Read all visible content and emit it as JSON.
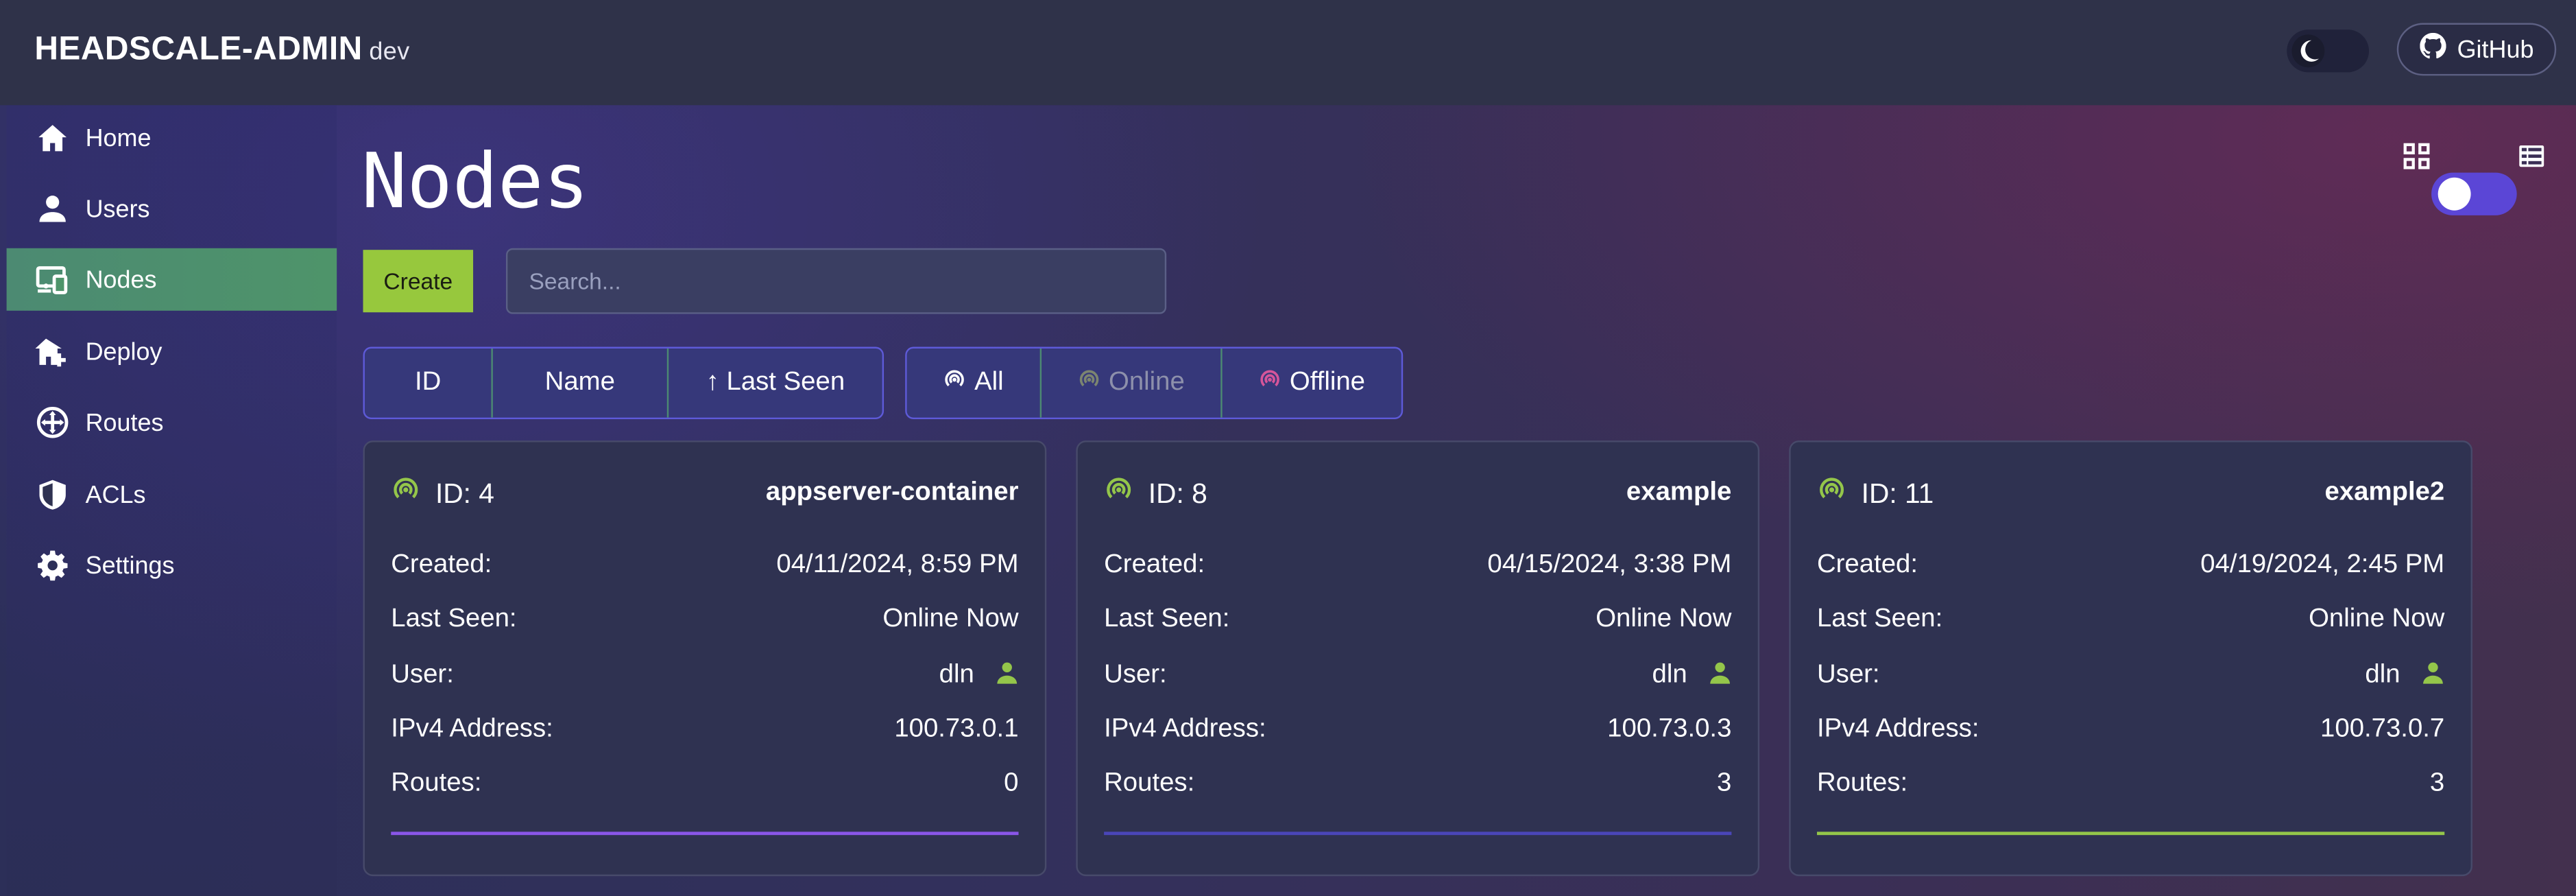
{
  "app": {
    "title": "HEADSCALE-ADMIN",
    "tag": "dev",
    "github_label": "GitHub"
  },
  "sidebar": {
    "items": [
      {
        "label": "Home",
        "icon": "home-icon",
        "active": false
      },
      {
        "label": "Users",
        "icon": "user-icon",
        "active": false
      },
      {
        "label": "Nodes",
        "icon": "devices-icon",
        "active": true
      },
      {
        "label": "Deploy",
        "icon": "deploy-icon",
        "active": false
      },
      {
        "label": "Routes",
        "icon": "routes-icon",
        "active": false
      },
      {
        "label": "ACLs",
        "icon": "shield-icon",
        "active": false
      },
      {
        "label": "Settings",
        "icon": "gear-icon",
        "active": false
      }
    ]
  },
  "main": {
    "title": "Nodes",
    "create_label": "Create",
    "search_placeholder": "Search...",
    "sort_buttons": [
      "ID",
      "Name",
      "↑ Last Seen"
    ],
    "filter_buttons": [
      "All",
      "Online",
      "Offline"
    ],
    "view_mode": "list"
  },
  "nodes": [
    {
      "id_label": "ID: 4",
      "name": "appserver-container",
      "created": "04/11/2024, 8:59 PM",
      "last_seen": "Online Now",
      "user": "dln",
      "ipv4": "100.73.0.1",
      "routes": "0",
      "accent": "#8a56e8"
    },
    {
      "id_label": "ID: 8",
      "name": "example",
      "created": "04/15/2024, 3:38 PM",
      "last_seen": "Online Now",
      "user": "dln",
      "ipv4": "100.73.0.3",
      "routes": "3",
      "accent": "#4a46b8"
    },
    {
      "id_label": "ID: 11",
      "name": "example2",
      "created": "04/19/2024, 2:45 PM",
      "last_seen": "Online Now",
      "user": "dln",
      "ipv4": "100.73.0.7",
      "routes": "3",
      "accent": "#94c64a"
    }
  ],
  "labels": {
    "created": "Created:",
    "last_seen": "Last Seen:",
    "user": "User:",
    "ipv4": "IPv4 Address:",
    "routes": "Routes:"
  },
  "colors": {
    "online": "#94c64a",
    "offline": "#d6559a",
    "accent_primary": "#5b46d6",
    "active_nav": "#4e946a",
    "create_button": "#97c83d"
  }
}
